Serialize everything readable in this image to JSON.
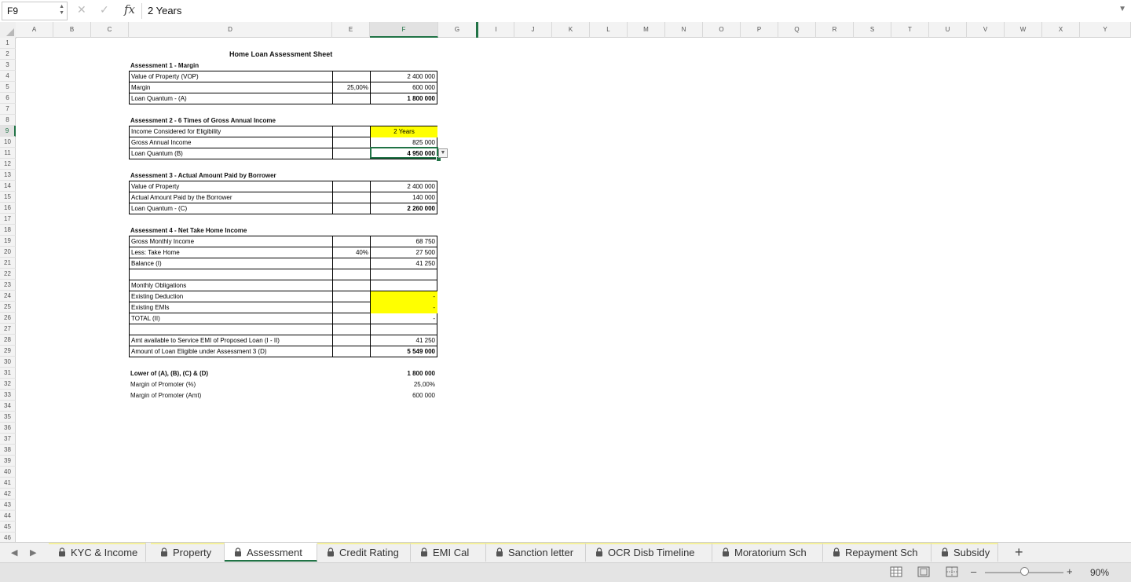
{
  "formula_bar": {
    "name_box": "F9",
    "cancel_icon": "x-icon",
    "confirm_icon": "check-icon",
    "fx_label": "fx",
    "content": "2 Years"
  },
  "columns": [
    "A",
    "B",
    "C",
    "D",
    "E",
    "F",
    "G",
    "I",
    "J",
    "K",
    "L",
    "M",
    "N",
    "O",
    "P",
    "Q",
    "R",
    "S",
    "T",
    "U",
    "V",
    "W",
    "X",
    "Y"
  ],
  "selected_column": "F",
  "rows": [
    "1",
    "2",
    "3",
    "4",
    "5",
    "6",
    "7",
    "8",
    "9",
    "10",
    "11",
    "12",
    "13",
    "14",
    "15",
    "16",
    "17",
    "18",
    "19",
    "20",
    "21",
    "22",
    "23",
    "24",
    "25",
    "26",
    "27",
    "28",
    "29",
    "30",
    "31",
    "32",
    "33",
    "34",
    "35",
    "36",
    "37",
    "38",
    "39",
    "40",
    "41",
    "42",
    "43",
    "44",
    "45",
    "46"
  ],
  "selected_row": "9",
  "sheet": {
    "title": "Home Loan Assessment Sheet",
    "a1": {
      "heading": "Assessment 1 - Margin",
      "rows": [
        {
          "label": "Value of Property (VOP)",
          "e": "",
          "f": "2 400 000"
        },
        {
          "label": "Margin",
          "e": "25,00%",
          "f": "600 000"
        },
        {
          "label": "Loan Quantum - (A)",
          "e": "",
          "f": "1 800 000",
          "bold": true
        }
      ]
    },
    "a2": {
      "heading": "Assessment 2 - 6 Times of Gross Annual Income",
      "rows": [
        {
          "label": "Income Considered for Eligibility",
          "e": "",
          "f": "2 Years"
        },
        {
          "label": "Gross Annual Income",
          "e": "",
          "f": "825 000"
        },
        {
          "label": "Loan Quantum (B)",
          "e": "",
          "f": "4 950 000",
          "bold": true
        }
      ]
    },
    "a3": {
      "heading": "Assessment 3 - Actual Amount Paid by Borrower",
      "rows": [
        {
          "label": "Value of Property",
          "e": "",
          "f": "2 400 000"
        },
        {
          "label": "Actual Amount Paid by the Borrower",
          "e": "",
          "f": "140 000"
        },
        {
          "label": "Loan Quantum - (C)",
          "e": "",
          "f": "2 260 000",
          "bold": true
        }
      ]
    },
    "a4": {
      "heading": "Assessment 4 - Net Take Home Income",
      "rows": [
        {
          "label": "Gross Monthly Income",
          "e": "",
          "f": "68 750"
        },
        {
          "label": "Less: Take Home",
          "e": "40%",
          "f": "27 500"
        },
        {
          "label": "Balance (I)",
          "e": "",
          "f": "41 250"
        },
        {
          "label": "",
          "e": "",
          "f": ""
        },
        {
          "label": "Monthly Obligations",
          "e": "",
          "f": ""
        },
        {
          "label": "Existing Deduction",
          "e": "",
          "f": "-",
          "yellow": true
        },
        {
          "label": "Existing EMIs",
          "e": "",
          "f": "-",
          "yellow": true
        },
        {
          "label": "TOTAL (II)",
          "e": "",
          "f": "-"
        },
        {
          "label": "",
          "e": "",
          "f": ""
        },
        {
          "label": "Amt available to Service EMI of Proposed Loan (I - II)",
          "e": "",
          "f": "41 250"
        },
        {
          "label": "Amount of Loan Eligible under Assessment 3 (D)",
          "e": "",
          "f": "5 549 000",
          "bold": true
        }
      ]
    },
    "summary": [
      {
        "label": "Lower of (A), (B), (C) & (D)",
        "f": "1 800 000",
        "bold": true
      },
      {
        "label": "Margin of Promoter (%)",
        "f": "25,00%"
      },
      {
        "label": "Margin of Promoter (Amt)",
        "f": "600 000"
      }
    ]
  },
  "tabs": [
    {
      "label": "KYC & Income",
      "active": false
    },
    {
      "label": "Property",
      "active": false
    },
    {
      "label": "Assessment",
      "active": true
    },
    {
      "label": "Credit Rating",
      "active": false
    },
    {
      "label": "EMI Cal",
      "active": false
    },
    {
      "label": "Sanction letter",
      "active": false
    },
    {
      "label": "OCR Disb Timeline",
      "active": false
    },
    {
      "label": "Moratorium Sch",
      "active": false
    },
    {
      "label": "Repayment Sch",
      "active": false
    },
    {
      "label": "Subsidy",
      "active": false
    }
  ],
  "add_tab_label": "+",
  "status": {
    "zoom": "90%",
    "zoom_minus": "–",
    "zoom_plus": "+",
    "zoom_level": 0.5
  }
}
